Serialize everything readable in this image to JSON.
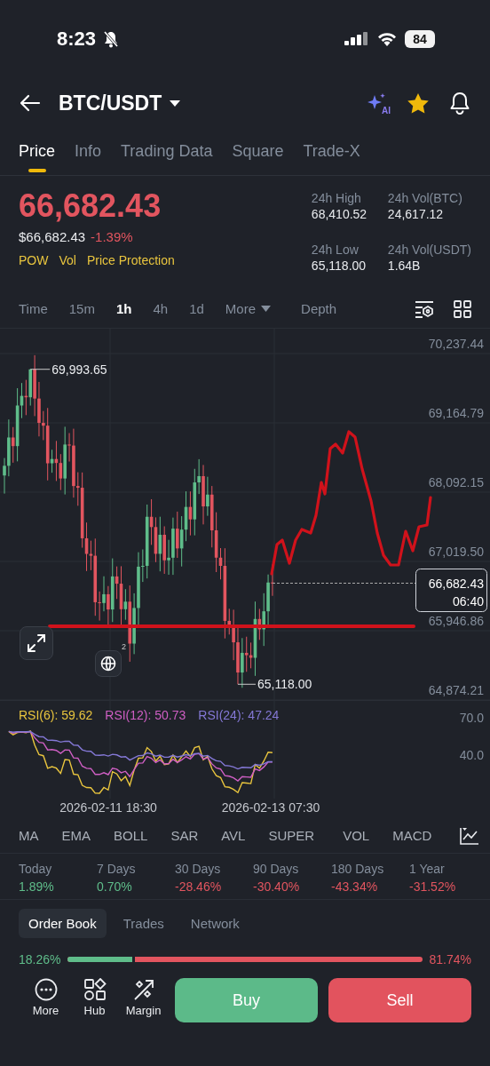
{
  "status_bar": {
    "time": "8:23",
    "battery": "84"
  },
  "header": {
    "pair": "BTC/USDT",
    "ai_badge": "AI"
  },
  "tabs": [
    {
      "label": "Price",
      "selected": true
    },
    {
      "label": "Info",
      "selected": false
    },
    {
      "label": "Trading Data",
      "selected": false
    },
    {
      "label": "Square",
      "selected": false
    },
    {
      "label": "Trade-X",
      "selected": false
    }
  ],
  "price": {
    "last": "66,682.43",
    "usd": "$66,682.43",
    "change": "-1.39%",
    "tags": [
      "POW",
      "Vol",
      "Price Protection"
    ]
  },
  "stats": [
    {
      "label": "24h High",
      "value": "68,410.52"
    },
    {
      "label": "24h Vol(BTC)",
      "value": "24,617.12"
    },
    {
      "label": "24h Low",
      "value": "65,118.00"
    },
    {
      "label": "24h Vol(USDT)",
      "value": "1.64B"
    }
  ],
  "intervals": [
    {
      "label": "Time",
      "kind": "tab",
      "selected": false
    },
    {
      "label": "15m",
      "kind": "tab",
      "selected": false
    },
    {
      "label": "1h",
      "kind": "tab",
      "selected": true
    },
    {
      "label": "4h",
      "kind": "tab",
      "selected": false
    },
    {
      "label": "1d",
      "kind": "tab",
      "selected": false
    },
    {
      "label": "More",
      "kind": "dropdown",
      "selected": false
    },
    {
      "label": "Depth",
      "kind": "tab",
      "selected": false
    }
  ],
  "chart": {
    "price_axis": [
      "70,237.44",
      "69,164.79",
      "68,092.15",
      "67,019.50",
      "65,946.86",
      "64,874.21"
    ],
    "high_marker": "69,993.65",
    "low_marker": "65,118.00",
    "current_price": "66,682.43",
    "countdown": "06:40",
    "globe_badge": "2"
  },
  "rsi": {
    "legend": [
      {
        "label": "RSI(6): 59.62",
        "color": "#e9c53e"
      },
      {
        "label": "RSI(12): 50.73",
        "color": "#cf5fc4"
      },
      {
        "label": "RSI(24): 47.24",
        "color": "#8478d6"
      }
    ],
    "axis": [
      "70.0",
      "40.0"
    ],
    "dates": [
      "2026-02-11 18:30",
      "2026-02-13 07:30"
    ]
  },
  "indicators": {
    "main": [
      "MA",
      "EMA",
      "BOLL",
      "SAR",
      "AVL",
      "SUPER"
    ],
    "sub": [
      "VOL",
      "MACD"
    ]
  },
  "performance": [
    {
      "period": "Today",
      "change": "1.89%",
      "color": "#5fbd8a"
    },
    {
      "period": "7 Days",
      "change": "0.70%",
      "color": "#5fbd8a"
    },
    {
      "period": "30 Days",
      "change": "-28.46%",
      "color": "#e2555f"
    },
    {
      "period": "90 Days",
      "change": "-30.40%",
      "color": "#e2555f"
    },
    {
      "period": "180 Days",
      "change": "-43.34%",
      "color": "#e2555f"
    },
    {
      "period": "1 Year",
      "change": "-31.52%",
      "color": "#e2555f"
    }
  ],
  "book_tabs": [
    {
      "label": "Order Book",
      "selected": true
    },
    {
      "label": "Trades",
      "selected": false
    },
    {
      "label": "Network",
      "selected": false
    }
  ],
  "ratio": {
    "buy": "18.26%",
    "sell": "81.74%",
    "level": 0.1826
  },
  "bottom_nav": [
    {
      "label": "More",
      "kind": "more"
    },
    {
      "label": "Hub",
      "kind": "hub"
    },
    {
      "label": "Margin",
      "kind": "margin"
    }
  ],
  "actions": {
    "buy": "Buy",
    "sell": "Sell"
  }
}
